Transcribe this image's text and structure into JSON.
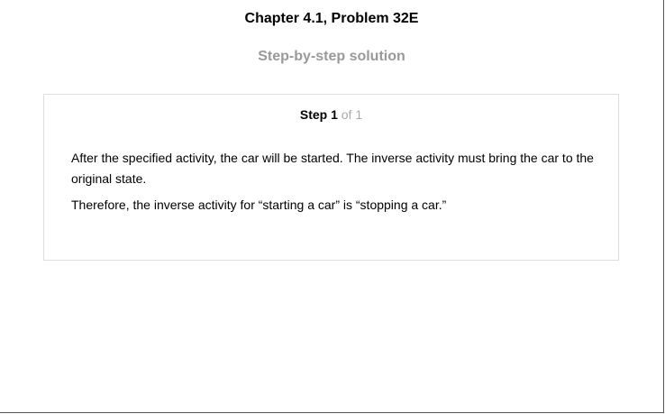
{
  "header": {
    "title": "Chapter 4.1, Problem 32E",
    "subtitle": "Step-by-step solution"
  },
  "step": {
    "label": "Step 1",
    "of": "of 1",
    "paragraphs": [
      "After the specified activity, the car will be started. The inverse activity must bring the car to the original state.",
      "Therefore, the inverse activity for “starting a car” is “stopping a car.”"
    ]
  }
}
